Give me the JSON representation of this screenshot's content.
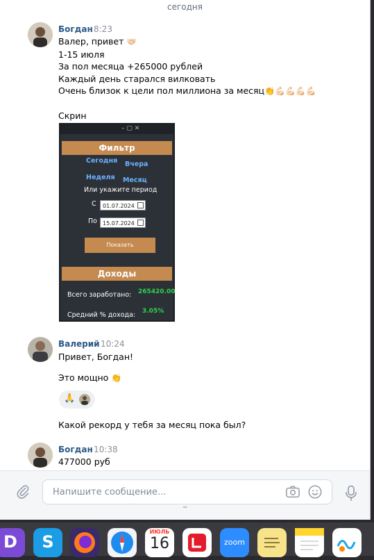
{
  "date_separator": "сегодня",
  "messages": [
    {
      "author": "Богдан",
      "time": "8:23",
      "lines": [
        "Валер, привет",
        "1-15 июля",
        "За пол месяца +265000 рублей",
        "Каждый день старался вилковать",
        "Очень близок к цели пол миллиона за месяц",
        "",
        "Скрин"
      ],
      "emoji_greeting": "🤝🏻",
      "emoji_goal": "👏💪🏻💪🏻💪🏻💪🏻"
    },
    {
      "author": "Валерий",
      "time": "10:24",
      "lines": [
        "Привет, Богдан!",
        "Это мощно",
        "Какой рекорд у тебя за месяц пока был?"
      ],
      "emoji_wow": "👏"
    },
    {
      "author": "Богдан",
      "time": "10:38",
      "lines": [
        "477000 руб"
      ]
    }
  ],
  "screenshot": {
    "filter_title": "Фильтр",
    "today": "Сегодня",
    "yesterday": "Вчера",
    "week": "Неделя",
    "month": "Месяц",
    "period_prompt": "Или укажите период",
    "from_label": "С",
    "from_date": "01.07.2024",
    "to_label": "По",
    "to_date": "15.07.2024",
    "show_button": "Показать",
    "income_title": "Доходы",
    "total_label": "Всего заработано:",
    "total_value": "265420.00",
    "avg_label": "Средний % дохода:",
    "avg_value": "3.05%",
    "window_controls": "–  ▢  ✕"
  },
  "reactions": {
    "emoji": "🙏"
  },
  "composer": {
    "placeholder": "Напишите сообщение..."
  },
  "dock": {
    "calendar_month": "ИЮЛЬ",
    "calendar_day": "16",
    "zoom_label": "zoom",
    "icons": [
      "discord-like-icon",
      "skype-icon",
      "firefox-icon",
      "safari-icon",
      "calendar-icon",
      "lightroom-like-icon",
      "zoom-icon",
      "stickies-icon",
      "notes-icon",
      "freeform-icon"
    ]
  },
  "colors": {
    "link": "#2a5885",
    "accent": "#c48a4f",
    "green": "#2fd14a"
  }
}
